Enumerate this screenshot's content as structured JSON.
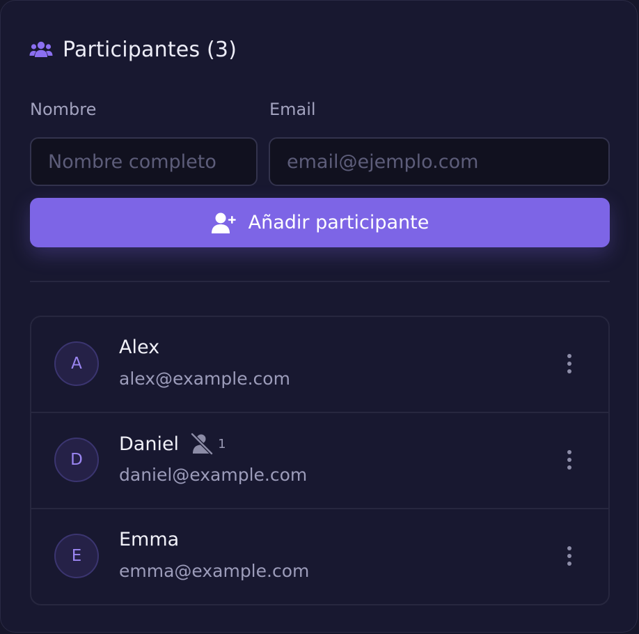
{
  "header": {
    "title": "Participantes (3)",
    "icon": "users-icon"
  },
  "form": {
    "name_label": "Nombre",
    "name_placeholder": "Nombre completo",
    "name_value": "",
    "email_label": "Email",
    "email_placeholder": "email@ejemplo.com",
    "email_value": "",
    "add_label": "Añadir participante"
  },
  "participants": [
    {
      "initial": "A",
      "name": "Alex",
      "email": "alex@example.com"
    },
    {
      "initial": "D",
      "name": "Daniel",
      "email": "daniel@example.com",
      "excluded_count": "1"
    },
    {
      "initial": "E",
      "name": "Emma",
      "email": "emma@example.com"
    }
  ],
  "colors": {
    "accent": "#7d65e6",
    "background": "#181830",
    "avatar_text": "#9b86f2"
  }
}
